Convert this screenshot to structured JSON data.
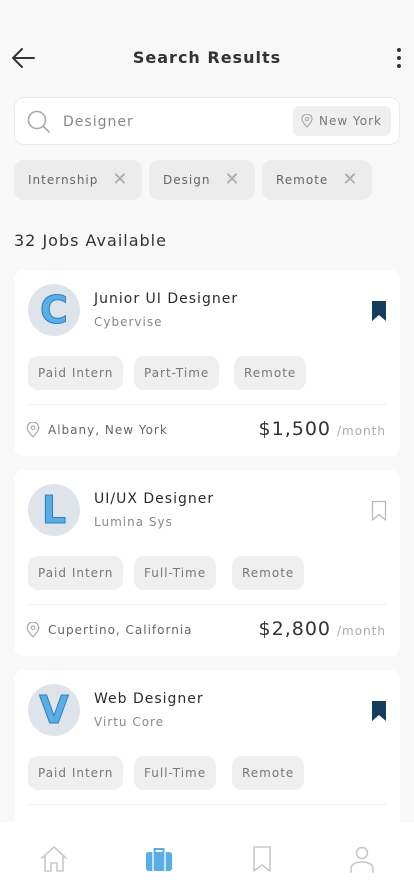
{
  "header": {
    "title": "Search Results"
  },
  "search": {
    "value": "Designer",
    "location": "New York"
  },
  "filters": [
    "Internship",
    "Design",
    "Remote"
  ],
  "results_count": "32 Jobs Available",
  "jobs": [
    {
      "logo": "C",
      "title": "Junior UI Designer",
      "company": "Cybervise",
      "tags": [
        "Paid Intern",
        "Part-Time",
        "Remote"
      ],
      "location": "Albany, New York",
      "salary": "$1,500",
      "period": "/month",
      "saved": true
    },
    {
      "logo": "L",
      "title": "UI/UX Designer",
      "company": "Lumina Sys",
      "tags": [
        "Paid Intern",
        "Full-Time",
        "Remote"
      ],
      "location": "Cupertino, California",
      "salary": "$2,800",
      "period": "/month",
      "saved": false
    },
    {
      "logo": "V",
      "title": "Web Designer",
      "company": "Virtu Core",
      "tags": [
        "Paid Intern",
        "Full-Time",
        "Remote"
      ],
      "location": "",
      "salary": "",
      "period": "",
      "saved": true
    }
  ],
  "nav": [
    {
      "icon": "home-icon",
      "active": false
    },
    {
      "icon": "briefcase-icon",
      "active": true
    },
    {
      "icon": "bookmark-icon",
      "active": false
    },
    {
      "icon": "profile-icon",
      "active": false
    }
  ],
  "colors": {
    "accent": "#5aaee6",
    "bookmark": "#163e5c",
    "inactive": "#c8c8c8"
  }
}
